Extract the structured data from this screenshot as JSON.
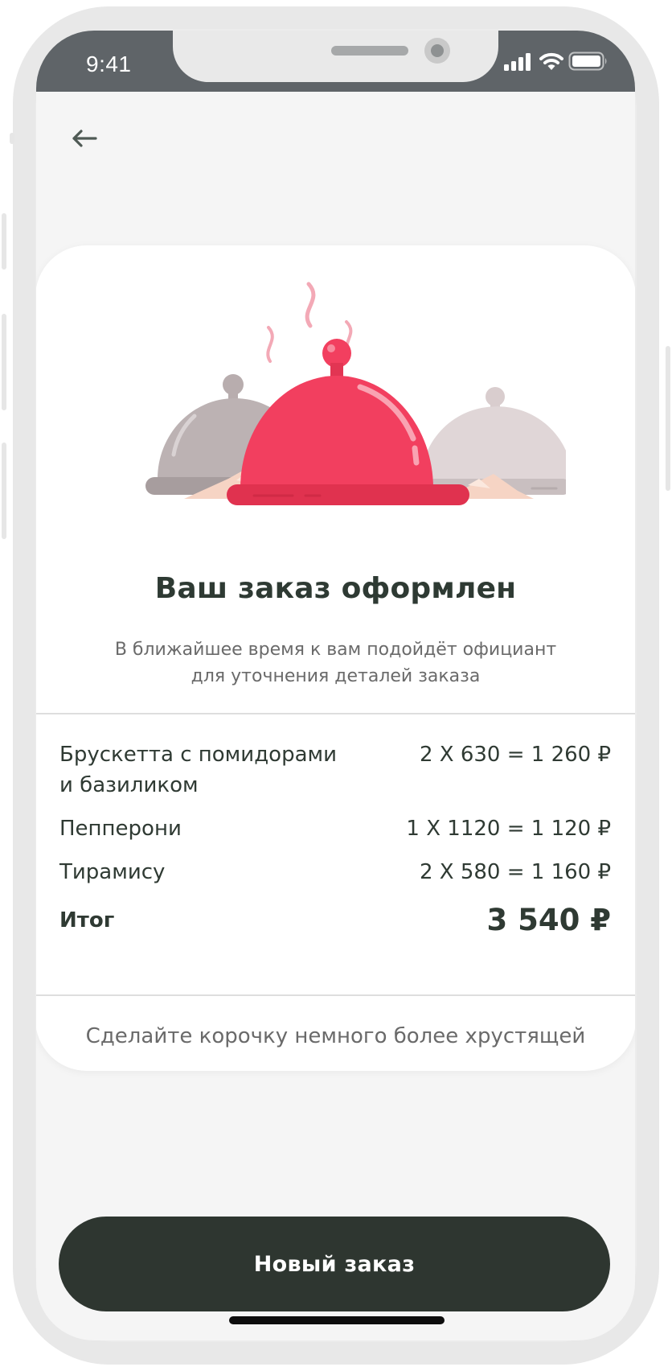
{
  "status_bar": {
    "time": "9:41"
  },
  "order": {
    "title": "Ваш заказ оформлен",
    "subtitle_line1": "В ближайшее время к вам подойдёт официант",
    "subtitle_line2": "для уточнения деталей заказа",
    "items": [
      {
        "name_line1": "Брускетта с помидорами",
        "name_line2": "и базиликом",
        "price": "2 X 630 = 1 260 ₽"
      },
      {
        "name_line1": "Пепперони",
        "price": "1 X 1120 = 1 120 ₽"
      },
      {
        "name_line1": "Тирамису",
        "price": "2 X 580 = 1 160 ₽"
      }
    ],
    "total_label": "Итог",
    "total_value": "3 540 ₽",
    "comment": "Сделайте корочку немного более хрустящей"
  },
  "actions": {
    "new_order_label": "Новый заказ"
  },
  "colors": {
    "accent": "#f23f5f",
    "button": "#2e3630",
    "text_dark": "#2f3a33",
    "status_bar": "#5f6468"
  },
  "icons": {
    "back": "arrow-left-icon",
    "signal": "signal-icon",
    "wifi": "wifi-icon",
    "battery": "battery-icon"
  }
}
